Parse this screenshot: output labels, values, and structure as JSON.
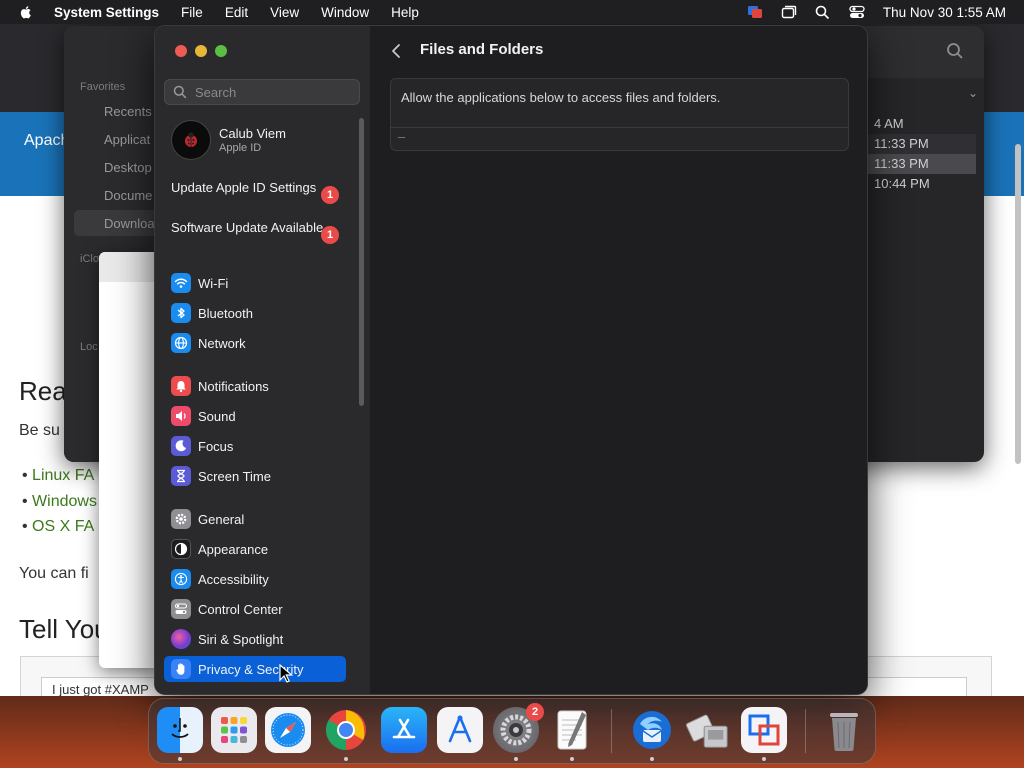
{
  "menubar": {
    "app": "System Settings",
    "items": [
      "File",
      "Edit",
      "View",
      "Window",
      "Help"
    ],
    "clock": "Thu Nov 30  1:55 AM"
  },
  "browser": {
    "banner_text": "Apach",
    "heading1": "Rea",
    "line1": "Be su",
    "links": [
      "Linux FA",
      "Windows",
      "OS X FA"
    ],
    "line2": "You can fi",
    "heading2": "Tell You",
    "tweet": "I just got #XAMP"
  },
  "finder": {
    "sidebar_heads": [
      "Favorites",
      "iClo",
      "Loc"
    ],
    "sidebar_items": [
      "Recents",
      "Applicat",
      "Desktop",
      "Docume",
      "Downloa"
    ],
    "times": [
      "4 AM",
      "11:33 PM",
      "11:33 PM",
      "10:44 PM"
    ]
  },
  "settings": {
    "search_placeholder": "Search",
    "account": {
      "name": "Calub Viem",
      "sub": "Apple ID"
    },
    "notices": [
      {
        "label": "Update Apple ID Settings",
        "badge": "1"
      },
      {
        "label": "Software Update Available",
        "badge": "1"
      }
    ],
    "items": [
      {
        "label": "Wi-Fi",
        "icon": "wifi-icon",
        "color": "#1a8cf0"
      },
      {
        "label": "Bluetooth",
        "icon": "bluetooth-icon",
        "color": "#1a8cf0"
      },
      {
        "label": "Network",
        "icon": "network-icon",
        "color": "#1a8cf0"
      },
      {
        "label": "Notifications",
        "icon": "bell-icon",
        "color": "#ec4c4e"
      },
      {
        "label": "Sound",
        "icon": "speaker-icon",
        "color": "#ec4c6a"
      },
      {
        "label": "Focus",
        "icon": "moon-icon",
        "color": "#5b5bd6"
      },
      {
        "label": "Screen Time",
        "icon": "hourglass-icon",
        "color": "#5b5bd6"
      },
      {
        "label": "General",
        "icon": "gear-icon",
        "color": "#8e8e93"
      },
      {
        "label": "Appearance",
        "icon": "appearance-icon",
        "color": "#1c1c1e"
      },
      {
        "label": "Accessibility",
        "icon": "accessibility-icon",
        "color": "#1a8cf0"
      },
      {
        "label": "Control Center",
        "icon": "toggles-icon",
        "color": "#8e8e93"
      },
      {
        "label": "Siri & Spotlight",
        "icon": "siri-icon",
        "color": "#7a3ccf"
      },
      {
        "label": "Privacy & Security",
        "icon": "hand-icon",
        "color": "#3a82f7"
      }
    ],
    "active_item": "Privacy & Security",
    "page_title": "Files and Folders",
    "description": "Allow the applications below to access files and folders.",
    "minus_label": "–"
  },
  "dock": {
    "apps": [
      "finder-icon",
      "launchpad-icon",
      "safari-icon",
      "chrome-icon",
      "app-store-icon",
      "xcode-instruments-icon",
      "system-settings-icon",
      "textedit-icon",
      "thunderbird-icon",
      "migration-assistant-icon",
      "vmware-icon",
      "trash-icon"
    ],
    "settings_badge": "2"
  }
}
